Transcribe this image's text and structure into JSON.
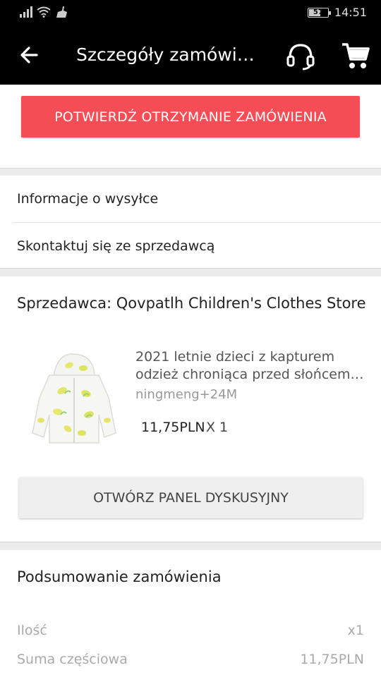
{
  "status_bar": {
    "battery": "57",
    "time": "14:51",
    "icons": [
      "signal-icon",
      "wifi-icon",
      "cleaner-icon",
      "battery-icon"
    ]
  },
  "header": {
    "title": "Szczegóły zamówien...",
    "back_icon": "arrow-left-icon",
    "support_icon": "headset-icon",
    "cart_icon": "cart-icon"
  },
  "confirm_button": {
    "label": "POTWIERDŹ OTRZYMANIE ZAMÓWIENIA",
    "color": "#f44d55"
  },
  "info_links": [
    {
      "label": "Informacje o wysyłce"
    },
    {
      "label": "Skontaktuj się ze sprzedawcą"
    }
  ],
  "seller": {
    "label": "Sprzedawca: Qovpatlh Children's Clothes Store"
  },
  "product": {
    "title_line1": "2021 letnie dzieci z kapturem",
    "title_line2": "odzież chroniąca przed słońcem ...",
    "variant": "ningmeng+24M",
    "price": "11,75PLN",
    "quantity": "X 1"
  },
  "dispute_button": {
    "label": "OTWÓRZ PANEL DYSKUSYJNY"
  },
  "summary": {
    "title": "Podsumowanie zamówienia",
    "rows": [
      {
        "label": "Ilość",
        "value": "x1"
      },
      {
        "label": "Suma częściowa",
        "value": "11,75PLN"
      }
    ]
  }
}
